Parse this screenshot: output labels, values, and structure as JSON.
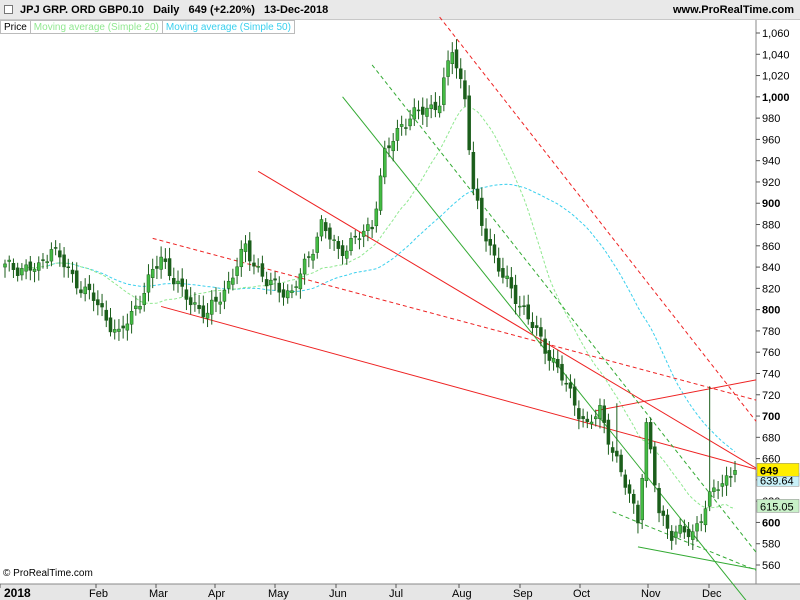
{
  "header": {
    "title": "JPJ GRP. ORD GBP0.10   Daily   649 (+2.20%)   13-Dec-2018",
    "site": "www.ProRealTime.com"
  },
  "legend": {
    "price_label": "Price",
    "ma20_label": "Moving average (Simple 20)",
    "ma50_label": "Moving average (Simple 50)"
  },
  "credit": "© ProRealTime.com",
  "colors": {
    "up": "#44bb44",
    "down": "#1b5e1b",
    "ma20": "#90e890",
    "ma50": "#3ad0ee",
    "trend_red": "#ee2222",
    "trend_green": "#33aa33",
    "price_tag": "#ffee00",
    "ma20_tag": "#c8f0c8",
    "ma50_tag": "#c8f0f8"
  },
  "chart_data": {
    "type": "candlestick",
    "y_ticks": [
      "1,060",
      "1,040",
      "1,020",
      "1,000",
      "980",
      "960",
      "940",
      "920",
      "900",
      "880",
      "860",
      "840",
      "820",
      "800",
      "780",
      "760",
      "740",
      "720",
      "700",
      "680",
      "660",
      "640",
      "620",
      "600",
      "580",
      "560"
    ],
    "ylim": [
      550,
      1070
    ],
    "x_labels": [
      "2018",
      "Feb",
      "Mar",
      "Apr",
      "May",
      "Jun",
      "Jul",
      "Aug",
      "Sep",
      "Oct",
      "Nov",
      "Dec"
    ],
    "last_price": "649",
    "ma50_value": "639.64",
    "ma20_value": "615.05",
    "anchors": [
      {
        "d": 0,
        "p": 840
      },
      {
        "d": 8,
        "p": 838
      },
      {
        "d": 11,
        "p": 860
      },
      {
        "d": 16,
        "p": 830
      },
      {
        "d": 21,
        "p": 810
      },
      {
        "d": 27,
        "p": 775
      },
      {
        "d": 32,
        "p": 810
      },
      {
        "d": 37,
        "p": 850
      },
      {
        "d": 42,
        "p": 815
      },
      {
        "d": 48,
        "p": 795
      },
      {
        "d": 53,
        "p": 825
      },
      {
        "d": 57,
        "p": 858
      },
      {
        "d": 62,
        "p": 825
      },
      {
        "d": 68,
        "p": 815
      },
      {
        "d": 72,
        "p": 850
      },
      {
        "d": 75,
        "p": 880
      },
      {
        "d": 79,
        "p": 855
      },
      {
        "d": 83,
        "p": 865
      },
      {
        "d": 87,
        "p": 880
      },
      {
        "d": 90,
        "p": 945
      },
      {
        "d": 94,
        "p": 975
      },
      {
        "d": 98,
        "p": 985
      },
      {
        "d": 103,
        "p": 995
      },
      {
        "d": 106,
        "p": 1045
      },
      {
        "d": 109,
        "p": 1000
      },
      {
        "d": 111,
        "p": 910
      },
      {
        "d": 113,
        "p": 880
      },
      {
        "d": 118,
        "p": 830
      },
      {
        "d": 123,
        "p": 800
      },
      {
        "d": 127,
        "p": 770
      },
      {
        "d": 130,
        "p": 752
      },
      {
        "d": 134,
        "p": 720
      },
      {
        "d": 138,
        "p": 690
      },
      {
        "d": 141,
        "p": 705
      },
      {
        "d": 146,
        "p": 645
      },
      {
        "d": 150,
        "p": 605
      },
      {
        "d": 152,
        "p": 690
      },
      {
        "d": 155,
        "p": 610
      },
      {
        "d": 158,
        "p": 590
      },
      {
        "d": 163,
        "p": 590
      },
      {
        "d": 166,
        "p": 615
      },
      {
        "d": 169,
        "p": 635
      },
      {
        "d": 173,
        "p": 649
      }
    ],
    "spikes": [
      {
        "d": 145,
        "high": 712
      },
      {
        "d": 167,
        "high": 728
      }
    ],
    "trendlines": [
      {
        "kind": "solid",
        "color": "red",
        "from": {
          "d": 37,
          "p": 803
        },
        "to": {
          "d": 178,
          "p": 650
        }
      },
      {
        "kind": "solid",
        "color": "red",
        "from": {
          "d": 60,
          "p": 930
        },
        "to": {
          "d": 178,
          "p": 651
        }
      },
      {
        "kind": "dashed",
        "color": "red",
        "from": {
          "d": 35,
          "p": 867
        },
        "to": {
          "d": 178,
          "p": 715
        }
      },
      {
        "kind": "dashed",
        "color": "red",
        "from": {
          "d": 103,
          "p": 1075
        },
        "to": {
          "d": 178,
          "p": 695
        }
      },
      {
        "kind": "solid",
        "color": "red",
        "from": {
          "d": 140,
          "p": 705
        },
        "to": {
          "d": 178,
          "p": 734
        }
      },
      {
        "kind": "solid",
        "color": "green",
        "from": {
          "d": 80,
          "p": 1000
        },
        "to": {
          "d": 178,
          "p": 515
        }
      },
      {
        "kind": "dashed",
        "color": "green",
        "from": {
          "d": 87,
          "p": 1030
        },
        "to": {
          "d": 178,
          "p": 572
        }
      },
      {
        "kind": "solid",
        "color": "green",
        "from": {
          "d": 150,
          "p": 577
        },
        "to": {
          "d": 178,
          "p": 556
        }
      },
      {
        "kind": "dashed",
        "color": "green",
        "from": {
          "d": 144,
          "p": 610
        },
        "to": {
          "d": 178,
          "p": 555
        }
      }
    ]
  }
}
